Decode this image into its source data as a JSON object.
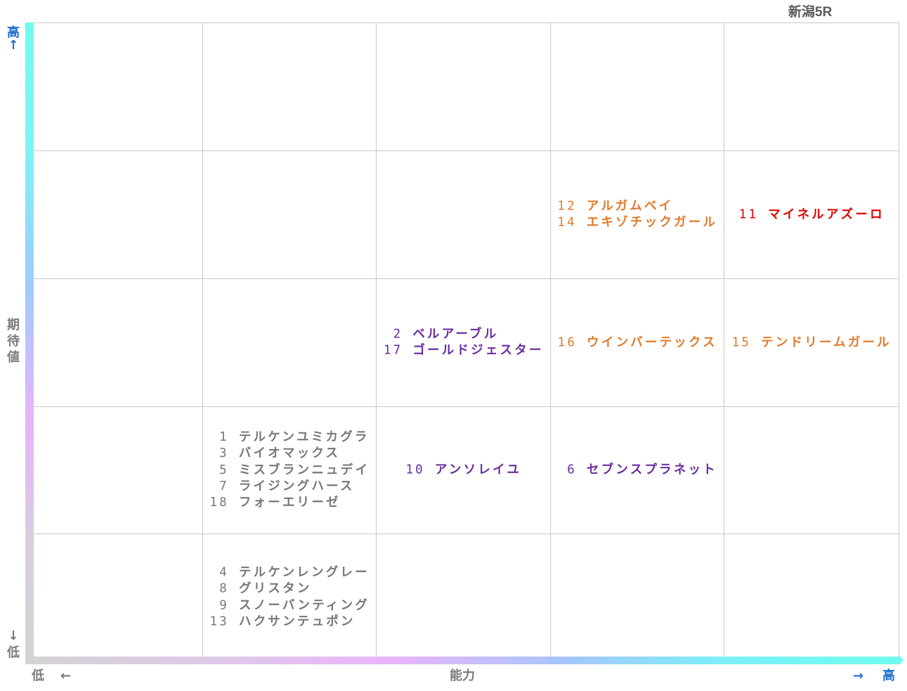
{
  "race_title": "新潟5R",
  "chart_data": {
    "type": "table",
    "title": "新潟5R",
    "xlabel": "能力",
    "ylabel": "期待値",
    "x_low_label": "低",
    "x_high_label": "高",
    "y_low_label": "低",
    "y_high_label": "高",
    "x_arrow_left": "←",
    "x_arrow_right": "→",
    "y_arrow_up": "↑",
    "y_arrow_down": "↓",
    "grid": true,
    "columns": 5,
    "rows": 5,
    "groups": [
      {
        "col": 3,
        "row": 3,
        "color": "#e07a2a",
        "horses": [
          {
            "number": "12",
            "name": "アルガムベイ"
          },
          {
            "number": "14",
            "name": "エキゾチックガール"
          }
        ]
      },
      {
        "col": 4,
        "row": 3,
        "color": "#e00000",
        "horses": [
          {
            "number": "11",
            "name": "マイネルアズーロ"
          }
        ]
      },
      {
        "col": 2,
        "row": 2,
        "color": "#6a2c9e",
        "horses": [
          {
            "number": "2",
            "name": "ベルアーブル"
          },
          {
            "number": "17",
            "name": "ゴールドジェスター"
          }
        ]
      },
      {
        "col": 3,
        "row": 2,
        "color": "#e07a2a",
        "horses": [
          {
            "number": "16",
            "name": "ウインバーテックス"
          }
        ]
      },
      {
        "col": 4,
        "row": 2,
        "color": "#e07a2a",
        "horses": [
          {
            "number": "15",
            "name": "テンドリームガール"
          }
        ]
      },
      {
        "col": 1,
        "row": 1,
        "color": "#777777",
        "horses": [
          {
            "number": "1",
            "name": "テルケンユミカグラ"
          },
          {
            "number": "3",
            "name": "バイオマックス"
          },
          {
            "number": "5",
            "name": "ミスブランニュデイ"
          },
          {
            "number": "7",
            "name": "ライジングハース"
          },
          {
            "number": "18",
            "name": "フォーエリーゼ"
          }
        ]
      },
      {
        "col": 2,
        "row": 1,
        "color": "#6a2c9e",
        "horses": [
          {
            "number": "10",
            "name": "アンソレイユ"
          }
        ]
      },
      {
        "col": 3,
        "row": 1,
        "color": "#6a2c9e",
        "horses": [
          {
            "number": "6",
            "name": "セブンスプラネット"
          }
        ]
      },
      {
        "col": 1,
        "row": 0,
        "color": "#777777",
        "horses": [
          {
            "number": "4",
            "name": "テルケンレングレー"
          },
          {
            "number": "8",
            "name": "グリスタン"
          },
          {
            "number": "9",
            "name": "スノーバンティング"
          },
          {
            "number": "13",
            "name": "ハクサンテュポン"
          }
        ]
      }
    ]
  }
}
